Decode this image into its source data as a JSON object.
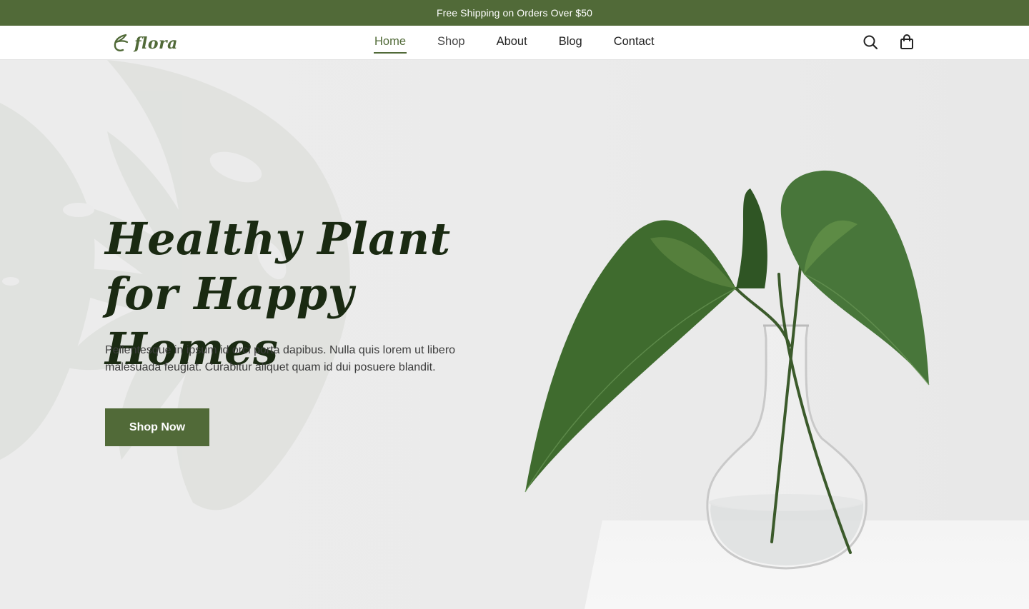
{
  "announcement": {
    "text": "Free Shipping on Orders Over $50"
  },
  "header": {
    "logo_text": "flora",
    "nav": [
      {
        "label": "Home",
        "active": true
      },
      {
        "label": "Shop"
      },
      {
        "label": "About"
      },
      {
        "label": "Blog"
      },
      {
        "label": "Contact"
      }
    ],
    "icons": [
      "search-icon",
      "shopping-bag-icon"
    ]
  },
  "hero": {
    "title": "Healthy Plant for Happy Homes",
    "description": "Pellentesque in ipsum id orci porta dapibus. Nulla quis lorem ut libero malesuada feugiat. Curabitur aliquet quam id dui posuere blandit.",
    "cta_label": "Shop Now"
  },
  "colors": {
    "brand": "#516a38",
    "title": "#1a2a12",
    "background": "#ebebeb"
  }
}
